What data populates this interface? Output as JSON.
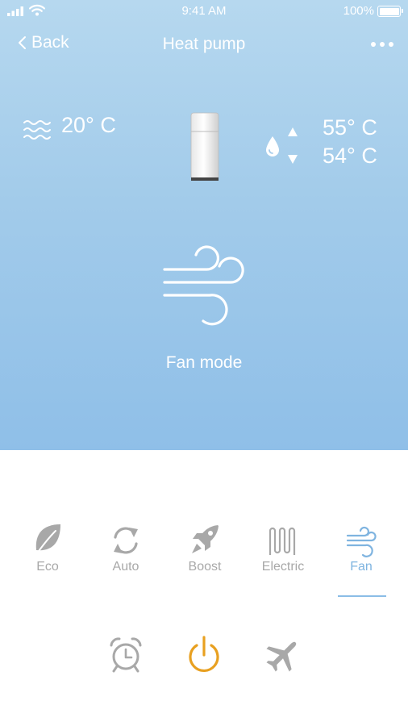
{
  "status_bar": {
    "time": "9:41 AM",
    "battery": "100%"
  },
  "nav": {
    "back_label": "Back",
    "title": "Heat pump"
  },
  "readings": {
    "ambient": "20° C",
    "target": "55° C",
    "current": "54° C"
  },
  "mode_label": "Fan mode",
  "modes": [
    {
      "label": "Eco",
      "icon": "leaf-icon"
    },
    {
      "label": "Auto",
      "icon": "refresh-icon"
    },
    {
      "label": "Boost",
      "icon": "rocket-icon"
    },
    {
      "label": "Electric",
      "icon": "heating-coil-icon"
    },
    {
      "label": "Fan",
      "icon": "wind-icon"
    }
  ],
  "active_mode": "Fan",
  "bottom_actions": [
    "alarm-clock-icon",
    "power-icon",
    "airplane-icon"
  ],
  "colors": {
    "hero_gradient_top": "#b6d8ef",
    "hero_gradient_bottom": "#8fbfe8",
    "active_mode": "#7fb4e0",
    "inactive_mode": "#a8a8a8",
    "power": "#e8a020"
  }
}
